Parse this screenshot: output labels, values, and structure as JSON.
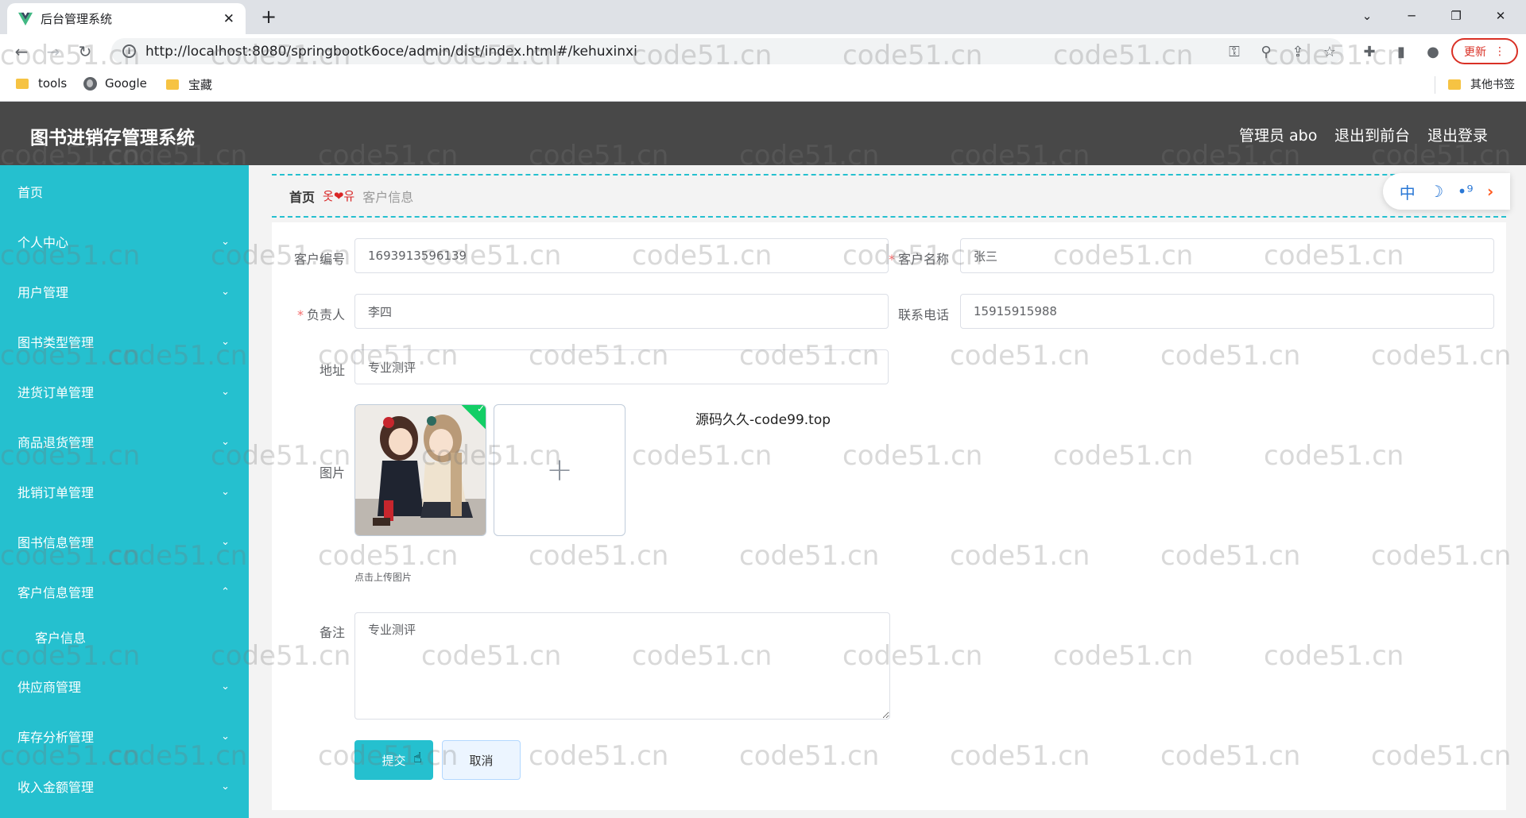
{
  "browser": {
    "tab_title": "后台管理系统",
    "tab_close": "✕",
    "new_tab": "+",
    "url": "http://localhost:8080/springbootk6oce/admin/dist/index.html#/kehuxinxi",
    "update_label": "更新",
    "bookmarks": [
      "tools",
      "Google",
      "宝藏"
    ],
    "other_bookmarks": "其他书签"
  },
  "header": {
    "title": "图书进销存管理系统",
    "admin": "管理员 abo",
    "to_front": "退出到前台",
    "logout": "退出登录"
  },
  "sidebar": {
    "items": [
      {
        "label": "首页",
        "expandable": false
      },
      {
        "label": "个人中心",
        "expandable": true
      },
      {
        "label": "用户管理",
        "expandable": true
      },
      {
        "label": "图书类型管理",
        "expandable": true
      },
      {
        "label": "进货订单管理",
        "expandable": true
      },
      {
        "label": "商品退货管理",
        "expandable": true
      },
      {
        "label": "批销订单管理",
        "expandable": true
      },
      {
        "label": "图书信息管理",
        "expandable": true
      },
      {
        "label": "客户信息管理",
        "expandable": true,
        "expanded": true
      },
      {
        "label": "客户信息",
        "sub": true
      },
      {
        "label": "供应商管理",
        "expandable": true
      },
      {
        "label": "库存分析管理",
        "expandable": true
      },
      {
        "label": "收入金额管理",
        "expandable": true
      }
    ]
  },
  "breadcrumb": {
    "home": "首页",
    "separator": "옷❤유",
    "current": "客户信息"
  },
  "float_tools": {
    "lang": "中"
  },
  "form": {
    "customer_no_label": "客户编号",
    "customer_no": "1693913596139",
    "customer_name_label": "客户名称",
    "customer_name": "张三",
    "owner_label": "负责人",
    "owner": "李四",
    "phone_label": "联系电话",
    "phone": "15915915988",
    "address_label": "地址",
    "address": "专业测评",
    "image_label": "图片",
    "upload_tip": "点击上传图片",
    "remark_label": "备注",
    "remark": "专业测评",
    "submit": "提交",
    "cancel": "取消",
    "overlay_note": "源码久久-code99.top"
  },
  "watermark": "code51.cn"
}
